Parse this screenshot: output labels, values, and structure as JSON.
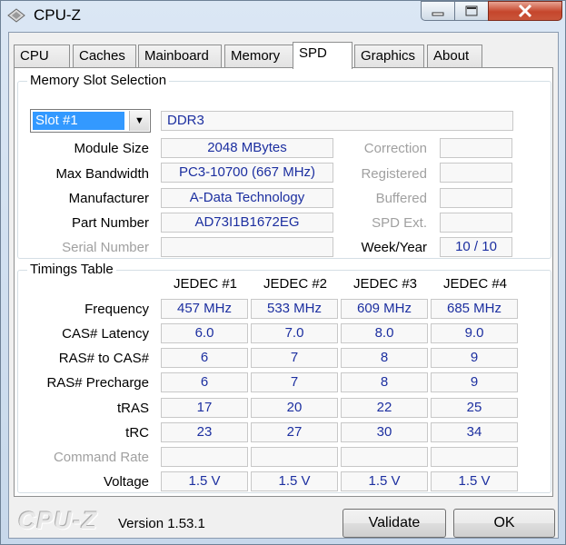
{
  "window": {
    "title": "CPU-Z"
  },
  "tabs": [
    {
      "label": "CPU"
    },
    {
      "label": "Caches"
    },
    {
      "label": "Mainboard"
    },
    {
      "label": "Memory"
    },
    {
      "label": "SPD",
      "active": true
    },
    {
      "label": "Graphics"
    },
    {
      "label": "About"
    }
  ],
  "slot_section": {
    "title": "Memory Slot Selection",
    "slot_select": {
      "value": "Slot #1"
    },
    "type": "DDR3",
    "rows": [
      {
        "label": "Module Size",
        "value": "2048 MBytes"
      },
      {
        "label": "Max Bandwidth",
        "value": "PC3-10700 (667 MHz)"
      },
      {
        "label": "Manufacturer",
        "value": "A-Data Technology"
      },
      {
        "label": "Part Number",
        "value": "AD73I1B1672EG"
      },
      {
        "label": "Serial Number",
        "value": ""
      }
    ],
    "right_rows": [
      {
        "label": "Correction",
        "value": ""
      },
      {
        "label": "Registered",
        "value": ""
      },
      {
        "label": "Buffered",
        "value": ""
      },
      {
        "label": "SPD Ext.",
        "value": ""
      },
      {
        "label": "Week/Year",
        "value": "10 / 10"
      }
    ]
  },
  "timings": {
    "title": "Timings Table",
    "headers": [
      "JEDEC #1",
      "JEDEC #2",
      "JEDEC #3",
      "JEDEC #4"
    ],
    "rows": [
      {
        "label": "Frequency",
        "values": [
          "457 MHz",
          "533 MHz",
          "609 MHz",
          "685 MHz"
        ]
      },
      {
        "label": "CAS# Latency",
        "values": [
          "6.0",
          "7.0",
          "8.0",
          "9.0"
        ]
      },
      {
        "label": "RAS# to CAS#",
        "values": [
          "6",
          "7",
          "8",
          "9"
        ]
      },
      {
        "label": "RAS# Precharge",
        "values": [
          "6",
          "7",
          "8",
          "9"
        ]
      },
      {
        "label": "tRAS",
        "values": [
          "17",
          "20",
          "22",
          "25"
        ]
      },
      {
        "label": "tRC",
        "values": [
          "23",
          "27",
          "30",
          "34"
        ]
      },
      {
        "label": "Command Rate",
        "values": [
          "",
          "",
          "",
          ""
        ]
      },
      {
        "label": "Voltage",
        "values": [
          "1.5 V",
          "1.5 V",
          "1.5 V",
          "1.5 V"
        ]
      }
    ]
  },
  "footer": {
    "brand": "CPU-Z",
    "version": "Version 1.53.1",
    "validate_label": "Validate",
    "ok_label": "OK"
  }
}
